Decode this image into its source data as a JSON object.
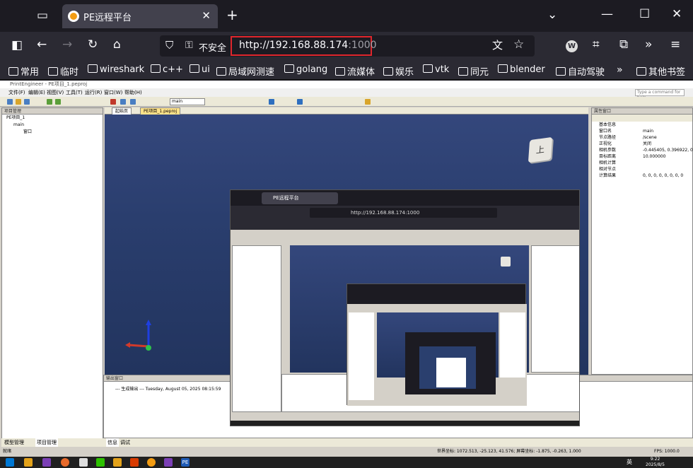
{
  "browser": {
    "tab_title": "PE远程平台",
    "insecure_label": "不安全",
    "url_host": "http://192.168.88.174",
    "url_port": ":1000"
  },
  "bookmarks": [
    "常用",
    "临时",
    "wireshark",
    "c++",
    "ui",
    "局域网测速",
    "golang",
    "流媒体",
    "娱乐",
    "vtk",
    "同元",
    "blender",
    "自动驾驶",
    "其他书签"
  ],
  "app": {
    "title": "PrintEngineer - PE项目_1.peproj",
    "menu": [
      "文件(F)",
      "编辑(E)",
      "视图(V)",
      "工具(T)",
      "运行(R)",
      "窗口(W)",
      "帮助(H)"
    ],
    "command_placeholder": "Type a command for help",
    "toolbar_combo": "main",
    "left_panel_title": "项目管理",
    "tree": [
      "PE项目_1",
      "main",
      "窗口"
    ],
    "left_tabs": [
      "模型管理",
      "项目管理"
    ],
    "viewport_tabs": [
      "起始页",
      "PE项目_1.peproj"
    ],
    "cube_label": "上",
    "right_panel_title": "属性窗口",
    "properties": [
      {
        "k": "基本信息",
        "v": ""
      },
      {
        "k": "窗口名",
        "v": "main"
      },
      {
        "k": "节点路径",
        "v": "/scene"
      },
      {
        "k": "正视化",
        "v": "关闭"
      },
      {
        "k": "相机参数",
        "v": "-0.445405, 0.396922, 0..."
      },
      {
        "k": "目标距离",
        "v": "10.000000"
      },
      {
        "k": "相机计算",
        "v": ""
      },
      {
        "k": "相对节点",
        "v": ""
      },
      {
        "k": "计算结果",
        "v": "0, 0, 0, 0, 0, 0, 0, 0"
      }
    ],
    "output_title": "输出窗口",
    "output_text": "--- 生成输出 --- Tuesday, August 05, 2025 08:15:59",
    "output_tabs": [
      "信息",
      "调试"
    ],
    "status_left": "就绪",
    "status_world": "世界坐标: 1072.513, -25.123, 41.576; 屏幕坐标: -1.875, -0.263, 1.000",
    "status_fps": "FPS: 1000.0"
  },
  "taskbar": {
    "ime": "英",
    "time": "9:22",
    "date": "2025/8/5"
  },
  "colors": {
    "browser_bg": "#1c1b22",
    "toolbar_bg": "#2b2a33",
    "url_highlight": "#e0262c",
    "viewport": "#2a3f6e"
  }
}
